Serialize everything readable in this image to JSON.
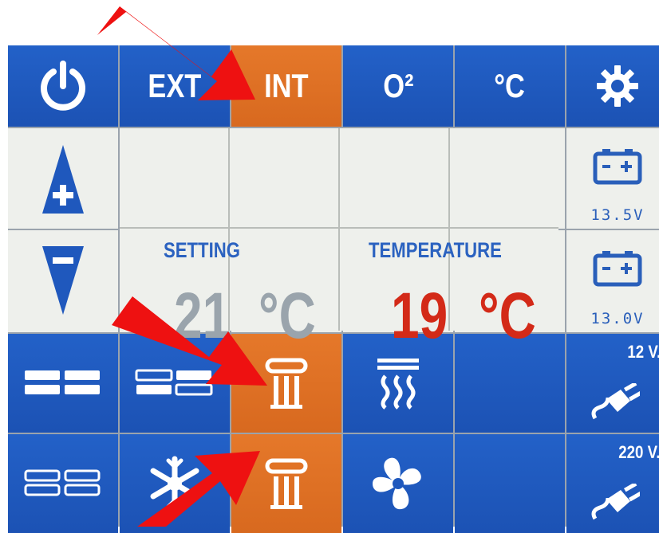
{
  "top_row": {
    "power_icon": "power-icon",
    "ext_label": "EXT",
    "int_label": "INT",
    "o2_label": "O²",
    "celsius_label": "°C",
    "settings_icon": "gear-icon"
  },
  "display": {
    "setting_label": "SETTING",
    "temperature_label": "TEMPERATURE",
    "setting_value": "21",
    "setting_unit": "°C",
    "temperature_value": "19",
    "temperature_unit": "°C"
  },
  "batteries": [
    {
      "icon": "battery-icon",
      "voltage": "13.5V"
    },
    {
      "icon": "battery-icon",
      "voltage": "13.0V"
    }
  ],
  "controls": {
    "up_icon": "plus-up-arrow-icon",
    "down_icon": "minus-down-arrow-icon",
    "power_12v_label": "12 V.",
    "power_220v_label": "220 V."
  },
  "colors": {
    "active": "#d8691f",
    "panel_blue": "#1c52b4",
    "setting_text": "#9aa4ac",
    "temperature_text": "#d32a18",
    "annotation_arrow": "#ee1111"
  }
}
